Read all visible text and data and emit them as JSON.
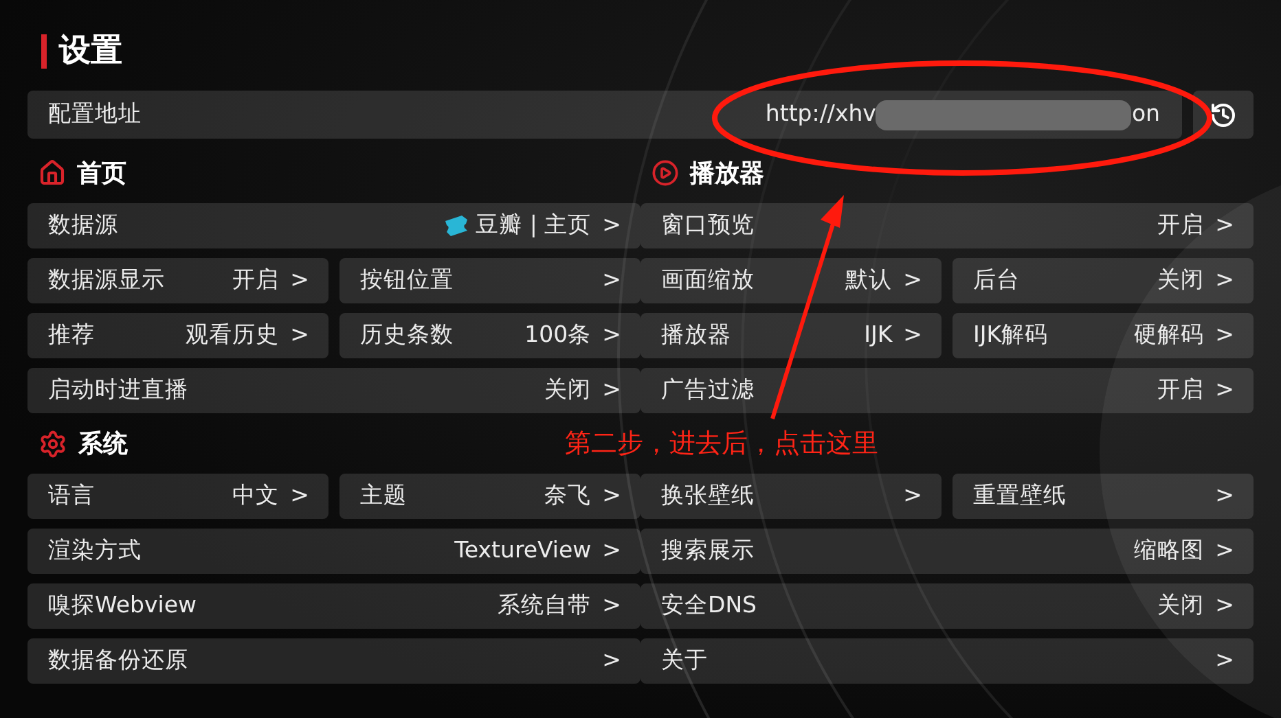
{
  "title": "设置",
  "config": {
    "label": "配置地址",
    "url_start": "http://xhv",
    "url_end": "on",
    "redacted": true
  },
  "left": [
    {
      "kind": "header",
      "label": "首页"
    },
    {
      "kind": "row",
      "cells": [
        {
          "label": "数据源",
          "value": "豆瓣 | 主页",
          "arrow": ">"
        }
      ]
    },
    {
      "kind": "row",
      "cells": [
        {
          "label": "数据源显示",
          "value": "开启",
          "arrow": ">"
        },
        {
          "label": "按钮位置",
          "arrow": ">"
        }
      ]
    },
    {
      "kind": "row",
      "cells": [
        {
          "label": "推荐",
          "value": "观看历史",
          "arrow": ">"
        },
        {
          "label": "历史条数",
          "value": "100条",
          "arrow": ">"
        }
      ]
    },
    {
      "kind": "row",
      "cells": [
        {
          "label": "启动时进直播",
          "value": "关闭",
          "arrow": ">"
        }
      ]
    },
    {
      "kind": "header",
      "label": "系统"
    },
    {
      "kind": "row",
      "cells": [
        {
          "label": "语言",
          "value": "中文",
          "arrow": ">"
        },
        {
          "label": "主题",
          "value": "奈飞",
          "arrow": ">"
        }
      ]
    },
    {
      "kind": "row",
      "cells": [
        {
          "label": "渲染方式",
          "value": "TextureView",
          "arrow": ">"
        }
      ]
    },
    {
      "kind": "row",
      "cells": [
        {
          "label": "嗅探Webview",
          "value": "系统自带",
          "arrow": ">"
        }
      ]
    },
    {
      "kind": "row",
      "cells": [
        {
          "label": "数据备份还原",
          "arrow": ">"
        }
      ]
    }
  ],
  "right": [
    {
      "kind": "header",
      "label": "播放器"
    },
    {
      "kind": "row",
      "cells": [
        {
          "label": "窗口预览",
          "value": "开启",
          "arrow": ">"
        }
      ]
    },
    {
      "kind": "row",
      "cells": [
        {
          "label": "画面缩放",
          "value": "默认",
          "arrow": ">"
        },
        {
          "label": "后台",
          "value": "关闭",
          "arrow": ">"
        }
      ]
    },
    {
      "kind": "row",
      "cells": [
        {
          "label": "播放器",
          "value": "IJK",
          "arrow": ">"
        },
        {
          "label": "IJK解码",
          "value": "硬解码",
          "arrow": ">"
        }
      ]
    },
    {
      "kind": "row",
      "cells": [
        {
          "label": "广告过滤",
          "value": "开启",
          "arrow": ">"
        }
      ]
    },
    {
      "kind": "note",
      "label": "第二步，进去后，点击这里"
    },
    {
      "kind": "row",
      "cells": [
        {
          "label": "换张壁纸",
          "arrow": ">"
        },
        {
          "label": "重置壁纸",
          "arrow": ">"
        }
      ]
    },
    {
      "kind": "row",
      "cells": [
        {
          "label": "搜索展示",
          "value": "缩略图",
          "arrow": ">"
        }
      ]
    },
    {
      "kind": "row",
      "cells": [
        {
          "label": "安全DNS",
          "value": "关闭",
          "arrow": ">"
        }
      ]
    },
    {
      "kind": "row",
      "cells": [
        {
          "label": "关于",
          "arrow": ">"
        }
      ]
    }
  ]
}
